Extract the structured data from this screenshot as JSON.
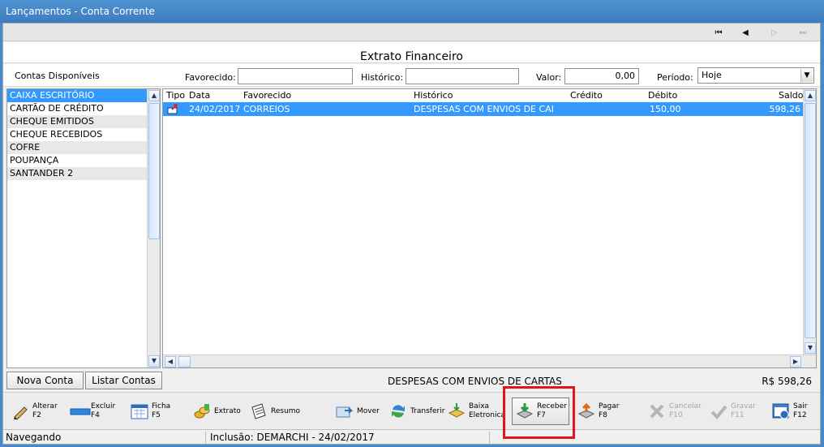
{
  "window": {
    "title": "Lançamentos - Conta Corrente"
  },
  "nav": {
    "first": "⏮",
    "prev": "◀",
    "next": "▷",
    "last": "⏭"
  },
  "header": {
    "title": "Extrato Financeiro"
  },
  "filters": {
    "contas_label": "Contas Disponíveis",
    "favorecido_label": "Favorecido:",
    "favorecido_value": "",
    "historico_label": "Histórico:",
    "historico_value": "",
    "valor_label": "Valor:",
    "valor_value": "0,00",
    "periodo_label": "Período:",
    "periodo_value": "Hoje"
  },
  "accounts": [
    "CAIXA ESCRITÓRIO",
    "CARTÃO DE CRÉDITO",
    "CHEQUE EMITIDOS",
    "CHEQUE RECEBIDOS",
    "COFRE",
    "POUPANÇA",
    "SANTANDER 2"
  ],
  "grid": {
    "columns": [
      "Tipo",
      "Data",
      "Favorecido",
      "Histórico",
      "Crédito",
      "Débito",
      "Saldo"
    ],
    "rows": [
      {
        "data": "24/02/2017",
        "favorecido": "CORREIOS",
        "historico": "DESPESAS COM ENVIOS DE CAI",
        "credito": "",
        "debito": "150,00",
        "saldo": "598,26"
      }
    ]
  },
  "buttons": {
    "nova_conta": "Nova Conta",
    "listar_contas": "Listar Contas"
  },
  "summary": {
    "description": "DESPESAS COM ENVIOS DE CARTAS",
    "total": "R$ 598,26"
  },
  "toolbar": [
    {
      "label": "Alterar",
      "key": "F2"
    },
    {
      "label": "Excluir",
      "key": "F4"
    },
    {
      "label": "Ficha",
      "key": "F5"
    },
    {
      "label": "Extrato",
      "key": ""
    },
    {
      "label": "Resumo",
      "key": ""
    },
    {
      "label": "Mover",
      "key": ""
    },
    {
      "label": "Transferir",
      "key": ""
    },
    {
      "label": "Baixa",
      "key": "Eletronica"
    },
    {
      "label": "Receber",
      "key": "F7"
    },
    {
      "label": "Pagar",
      "key": "F8"
    },
    {
      "label": "Cancelar",
      "key": "F10"
    },
    {
      "label": "Gravar",
      "key": "F11"
    },
    {
      "label": "Sair",
      "key": "F12"
    }
  ],
  "status": {
    "mode": "Navegando",
    "info": "Inclusão: DEMARCHI - 24/02/2017"
  }
}
